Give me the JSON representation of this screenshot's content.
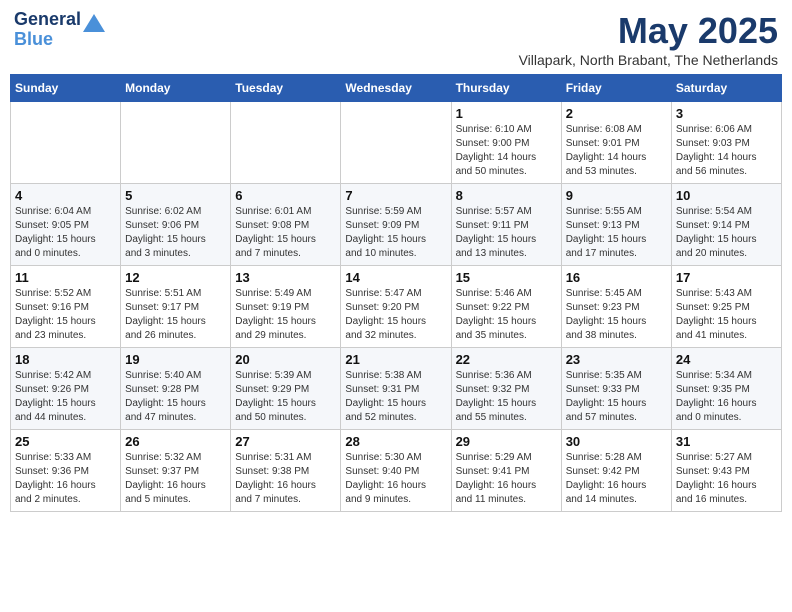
{
  "header": {
    "logo_line1": "General",
    "logo_line2": "Blue",
    "month": "May 2025",
    "location": "Villapark, North Brabant, The Netherlands"
  },
  "weekdays": [
    "Sunday",
    "Monday",
    "Tuesday",
    "Wednesday",
    "Thursday",
    "Friday",
    "Saturday"
  ],
  "weeks": [
    [
      {
        "day": "",
        "info": ""
      },
      {
        "day": "",
        "info": ""
      },
      {
        "day": "",
        "info": ""
      },
      {
        "day": "",
        "info": ""
      },
      {
        "day": "1",
        "info": "Sunrise: 6:10 AM\nSunset: 9:00 PM\nDaylight: 14 hours\nand 50 minutes."
      },
      {
        "day": "2",
        "info": "Sunrise: 6:08 AM\nSunset: 9:01 PM\nDaylight: 14 hours\nand 53 minutes."
      },
      {
        "day": "3",
        "info": "Sunrise: 6:06 AM\nSunset: 9:03 PM\nDaylight: 14 hours\nand 56 minutes."
      }
    ],
    [
      {
        "day": "4",
        "info": "Sunrise: 6:04 AM\nSunset: 9:05 PM\nDaylight: 15 hours\nand 0 minutes."
      },
      {
        "day": "5",
        "info": "Sunrise: 6:02 AM\nSunset: 9:06 PM\nDaylight: 15 hours\nand 3 minutes."
      },
      {
        "day": "6",
        "info": "Sunrise: 6:01 AM\nSunset: 9:08 PM\nDaylight: 15 hours\nand 7 minutes."
      },
      {
        "day": "7",
        "info": "Sunrise: 5:59 AM\nSunset: 9:09 PM\nDaylight: 15 hours\nand 10 minutes."
      },
      {
        "day": "8",
        "info": "Sunrise: 5:57 AM\nSunset: 9:11 PM\nDaylight: 15 hours\nand 13 minutes."
      },
      {
        "day": "9",
        "info": "Sunrise: 5:55 AM\nSunset: 9:13 PM\nDaylight: 15 hours\nand 17 minutes."
      },
      {
        "day": "10",
        "info": "Sunrise: 5:54 AM\nSunset: 9:14 PM\nDaylight: 15 hours\nand 20 minutes."
      }
    ],
    [
      {
        "day": "11",
        "info": "Sunrise: 5:52 AM\nSunset: 9:16 PM\nDaylight: 15 hours\nand 23 minutes."
      },
      {
        "day": "12",
        "info": "Sunrise: 5:51 AM\nSunset: 9:17 PM\nDaylight: 15 hours\nand 26 minutes."
      },
      {
        "day": "13",
        "info": "Sunrise: 5:49 AM\nSunset: 9:19 PM\nDaylight: 15 hours\nand 29 minutes."
      },
      {
        "day": "14",
        "info": "Sunrise: 5:47 AM\nSunset: 9:20 PM\nDaylight: 15 hours\nand 32 minutes."
      },
      {
        "day": "15",
        "info": "Sunrise: 5:46 AM\nSunset: 9:22 PM\nDaylight: 15 hours\nand 35 minutes."
      },
      {
        "day": "16",
        "info": "Sunrise: 5:45 AM\nSunset: 9:23 PM\nDaylight: 15 hours\nand 38 minutes."
      },
      {
        "day": "17",
        "info": "Sunrise: 5:43 AM\nSunset: 9:25 PM\nDaylight: 15 hours\nand 41 minutes."
      }
    ],
    [
      {
        "day": "18",
        "info": "Sunrise: 5:42 AM\nSunset: 9:26 PM\nDaylight: 15 hours\nand 44 minutes."
      },
      {
        "day": "19",
        "info": "Sunrise: 5:40 AM\nSunset: 9:28 PM\nDaylight: 15 hours\nand 47 minutes."
      },
      {
        "day": "20",
        "info": "Sunrise: 5:39 AM\nSunset: 9:29 PM\nDaylight: 15 hours\nand 50 minutes."
      },
      {
        "day": "21",
        "info": "Sunrise: 5:38 AM\nSunset: 9:31 PM\nDaylight: 15 hours\nand 52 minutes."
      },
      {
        "day": "22",
        "info": "Sunrise: 5:36 AM\nSunset: 9:32 PM\nDaylight: 15 hours\nand 55 minutes."
      },
      {
        "day": "23",
        "info": "Sunrise: 5:35 AM\nSunset: 9:33 PM\nDaylight: 15 hours\nand 57 minutes."
      },
      {
        "day": "24",
        "info": "Sunrise: 5:34 AM\nSunset: 9:35 PM\nDaylight: 16 hours\nand 0 minutes."
      }
    ],
    [
      {
        "day": "25",
        "info": "Sunrise: 5:33 AM\nSunset: 9:36 PM\nDaylight: 16 hours\nand 2 minutes."
      },
      {
        "day": "26",
        "info": "Sunrise: 5:32 AM\nSunset: 9:37 PM\nDaylight: 16 hours\nand 5 minutes."
      },
      {
        "day": "27",
        "info": "Sunrise: 5:31 AM\nSunset: 9:38 PM\nDaylight: 16 hours\nand 7 minutes."
      },
      {
        "day": "28",
        "info": "Sunrise: 5:30 AM\nSunset: 9:40 PM\nDaylight: 16 hours\nand 9 minutes."
      },
      {
        "day": "29",
        "info": "Sunrise: 5:29 AM\nSunset: 9:41 PM\nDaylight: 16 hours\nand 11 minutes."
      },
      {
        "day": "30",
        "info": "Sunrise: 5:28 AM\nSunset: 9:42 PM\nDaylight: 16 hours\nand 14 minutes."
      },
      {
        "day": "31",
        "info": "Sunrise: 5:27 AM\nSunset: 9:43 PM\nDaylight: 16 hours\nand 16 minutes."
      }
    ]
  ]
}
